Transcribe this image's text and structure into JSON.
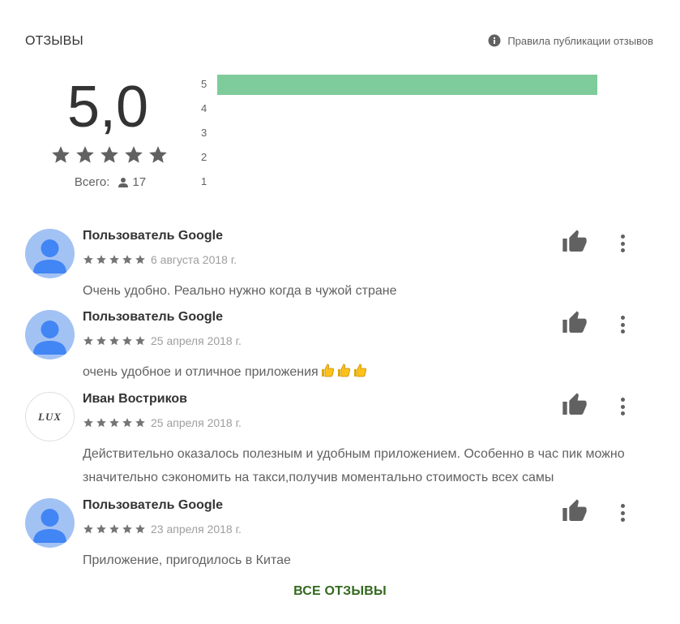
{
  "header": {
    "title": "ОТЗЫВЫ",
    "policy_link": "Правила публикации отзывов",
    "policy_icon": "info-icon"
  },
  "summary": {
    "score": "5,0",
    "stars": 5,
    "total_label": "Всего:",
    "total_count": "17",
    "total_icon": "person-icon"
  },
  "histogram": {
    "rows": [
      {
        "label": "5",
        "fraction": 1.0
      },
      {
        "label": "4",
        "fraction": 0
      },
      {
        "label": "3",
        "fraction": 0
      },
      {
        "label": "2",
        "fraction": 0
      },
      {
        "label": "1",
        "fraction": 0
      }
    ],
    "bar_color": "#7ecb9c"
  },
  "reviews": [
    {
      "author": "Пользователь Google",
      "avatar": "default-user-avatar",
      "stars": 5,
      "date": "6 августа 2018 г.",
      "text": "Очень удобно. Реально нужно когда в чужой стране",
      "emoji_count": 0
    },
    {
      "author": "Пользователь Google",
      "avatar": "default-user-avatar",
      "stars": 5,
      "date": "25 апреля 2018 г.",
      "text": "очень удобное и отличное приложения",
      "emoji_count": 3
    },
    {
      "author": "Иван Востриков",
      "avatar": "lux-logo-avatar",
      "avatar_text": "LUX",
      "stars": 5,
      "date": "25 апреля 2018 г.",
      "text": "Действительно оказалось полезным и удобным приложением. Особенно в час пик можно значительно сэкономить на такси,получив моментально стоимость всех самы",
      "emoji_count": 0
    },
    {
      "author": "Пользователь Google",
      "avatar": "default-user-avatar",
      "stars": 5,
      "date": "23 апреля 2018 г.",
      "text": "Приложение, пригодилось в Китае",
      "emoji_count": 0
    }
  ],
  "footer": {
    "all_reviews_label": "ВСЕ ОТЗЫВЫ"
  },
  "colors": {
    "accent_green": "#33691e",
    "star_gray": "#616161",
    "avatar_blue": "#a3c2f4",
    "avatar_dark_blue": "#4285f4"
  }
}
